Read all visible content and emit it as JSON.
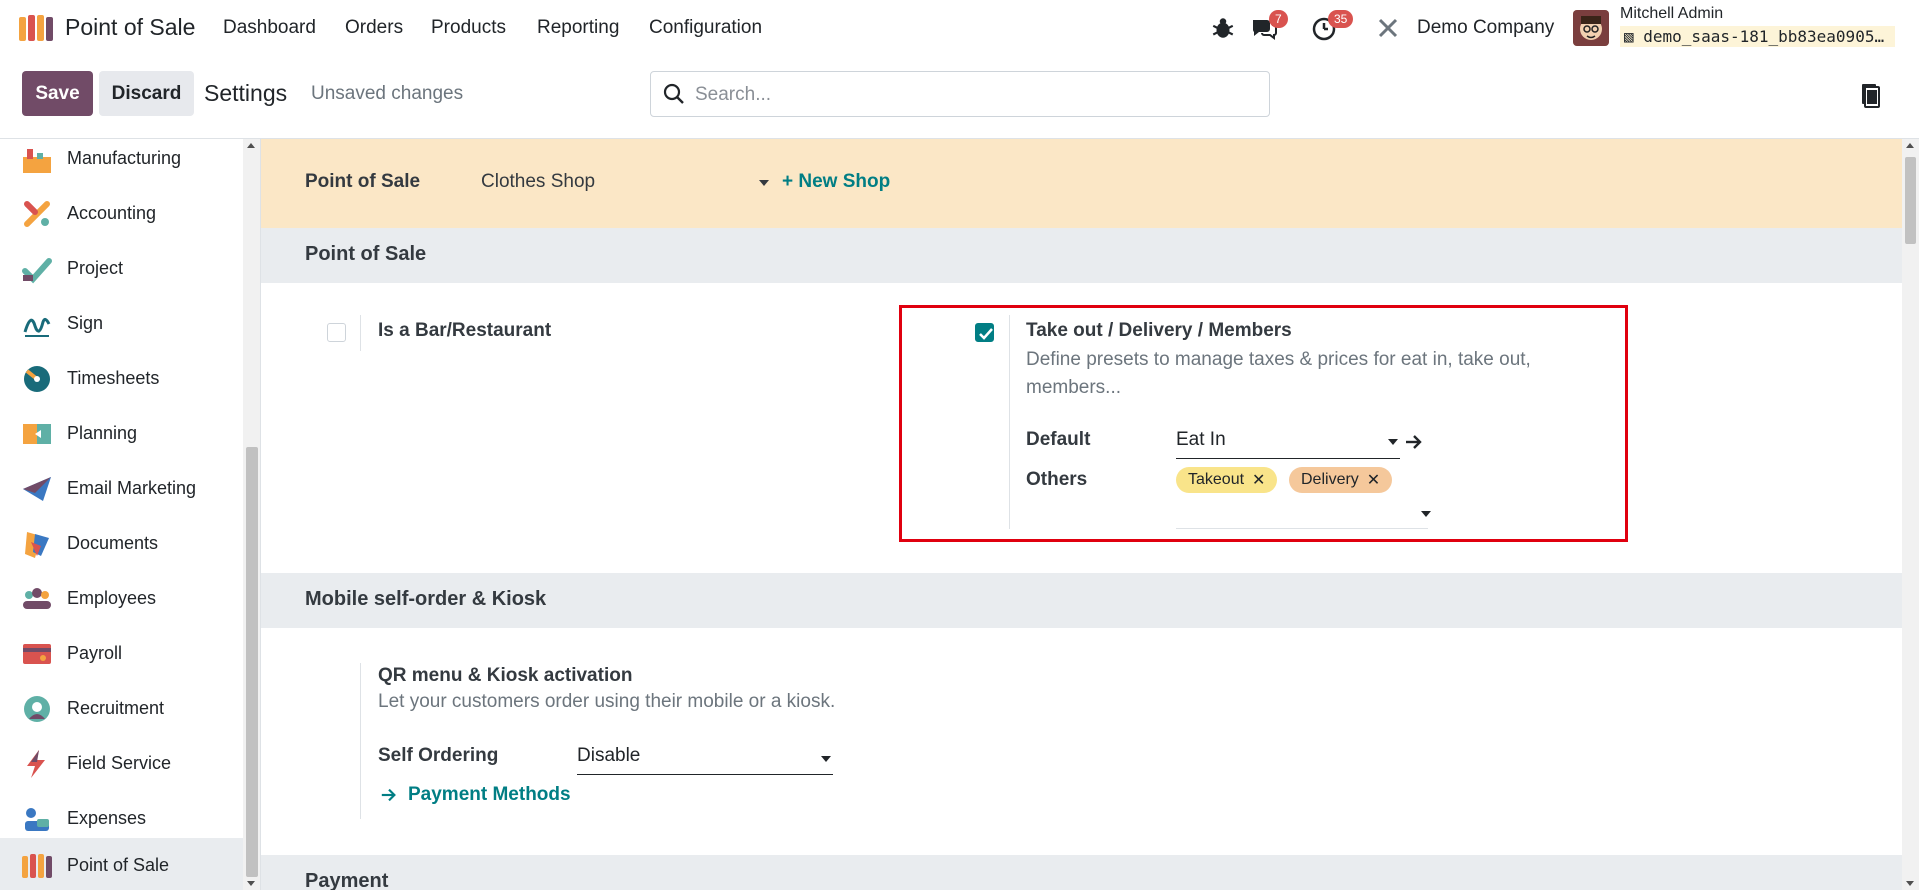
{
  "navbar": {
    "app_name": "Point of Sale",
    "menu": [
      "Dashboard",
      "Orders",
      "Products",
      "Reporting",
      "Configuration"
    ],
    "messages_badge": "7",
    "activities_badge": "35",
    "company": "Demo Company",
    "user_name": "Mitchell Admin",
    "db_name": "demo_saas-181_bb83ea0905…"
  },
  "control": {
    "save_label": "Save",
    "discard_label": "Discard",
    "title": "Settings",
    "status": "Unsaved changes",
    "search_placeholder": "Search..."
  },
  "sidebar": {
    "items": [
      {
        "label": "Manufacturing",
        "icon": "manufacturing-icon"
      },
      {
        "label": "Accounting",
        "icon": "accounting-icon"
      },
      {
        "label": "Project",
        "icon": "project-icon"
      },
      {
        "label": "Sign",
        "icon": "sign-icon"
      },
      {
        "label": "Timesheets",
        "icon": "timesheets-icon"
      },
      {
        "label": "Planning",
        "icon": "planning-icon"
      },
      {
        "label": "Email Marketing",
        "icon": "email-marketing-icon"
      },
      {
        "label": "Documents",
        "icon": "documents-icon"
      },
      {
        "label": "Employees",
        "icon": "employees-icon"
      },
      {
        "label": "Payroll",
        "icon": "payroll-icon"
      },
      {
        "label": "Recruitment",
        "icon": "recruitment-icon"
      },
      {
        "label": "Field Service",
        "icon": "field-service-icon"
      },
      {
        "label": "Expenses",
        "icon": "expenses-icon"
      },
      {
        "label": "Point of Sale",
        "icon": "point-of-sale-icon"
      }
    ],
    "active": "Point of Sale"
  },
  "shop_bar": {
    "label": "Point of Sale",
    "selected_shop": "Clothes Shop",
    "new_shop": "+ New Shop"
  },
  "pos_section": {
    "title": "Point of Sale",
    "bar_restaurant": {
      "label": "Is a Bar/Restaurant",
      "checked": false
    },
    "presets": {
      "title": "Take out / Delivery / Members",
      "description": "Define presets to manage taxes & prices for eat in, take out, members...",
      "checked": true,
      "default_label": "Default",
      "default_value": "Eat In",
      "others_label": "Others",
      "others_tags": [
        "Takeout",
        "Delivery"
      ]
    }
  },
  "self_order_section": {
    "title": "Mobile self-order & Kiosk",
    "setting_title": "QR menu & Kiosk activation",
    "description": "Let your customers order using their mobile or a kiosk.",
    "self_ordering_label": "Self Ordering",
    "self_ordering_value": "Disable",
    "payment_methods_link": "Payment Methods"
  },
  "payment_section": {
    "title": "Payment"
  },
  "colors": {
    "brand": "#714b67",
    "accent": "#017e84",
    "shop_bar_bg": "#fbe7c6",
    "highlight_border": "#e0000f",
    "tag_takeout": "#f9e48a",
    "tag_delivery": "#f5c89b"
  }
}
